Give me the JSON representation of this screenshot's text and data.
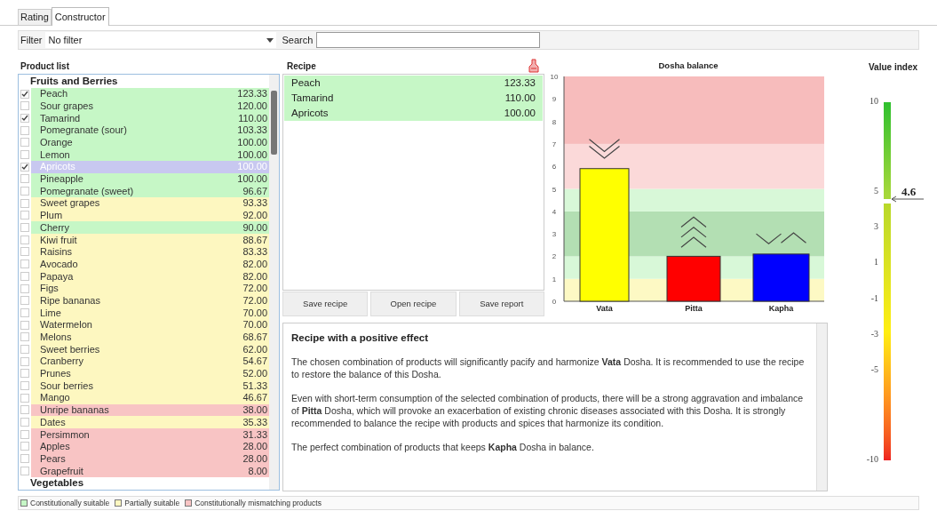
{
  "tabs": [
    {
      "label": "Rating",
      "selected": false
    },
    {
      "label": "Constructor",
      "selected": true
    }
  ],
  "filter": {
    "label": "Filter",
    "value": "No filter"
  },
  "search": {
    "label": "Search"
  },
  "product_list": {
    "title": "Product list",
    "groups": [
      {
        "name": "Fruits and Berries",
        "items": [
          {
            "name": "Peach",
            "value": "123.33",
            "checked": true,
            "selected": false,
            "color": "#c6f7c6"
          },
          {
            "name": "Sour grapes",
            "value": "120.00",
            "checked": false,
            "selected": false,
            "color": "#c6f7c6"
          },
          {
            "name": "Tamarind",
            "value": "110.00",
            "checked": true,
            "selected": false,
            "color": "#c6f7c6"
          },
          {
            "name": "Pomegranate (sour)",
            "value": "103.33",
            "checked": false,
            "selected": false,
            "color": "#c6f7c6"
          },
          {
            "name": "Orange",
            "value": "100.00",
            "checked": false,
            "selected": false,
            "color": "#c6f7c6"
          },
          {
            "name": "Lemon",
            "value": "100.00",
            "checked": false,
            "selected": false,
            "color": "#c6f7c6"
          },
          {
            "name": "Apricots",
            "value": "100.00",
            "checked": true,
            "selected": true
          },
          {
            "name": "Pineapple",
            "value": "100.00",
            "checked": false,
            "selected": false,
            "color": "#c6f7c6"
          },
          {
            "name": "Pomegranate (sweet)",
            "value": "96.67",
            "checked": false,
            "selected": false,
            "color": "#c6f7c6"
          },
          {
            "name": "Sweet grapes",
            "value": "93.33",
            "checked": false,
            "selected": false,
            "color": "#fdf7c0"
          },
          {
            "name": "Plum",
            "value": "92.00",
            "checked": false,
            "selected": false,
            "color": "#fdf7c0"
          },
          {
            "name": "Cherry",
            "value": "90.00",
            "checked": false,
            "selected": false,
            "color": "#c6f7c6"
          },
          {
            "name": "Kiwi fruit",
            "value": "88.67",
            "checked": false,
            "selected": false,
            "color": "#fdf7c0"
          },
          {
            "name": "Raisins",
            "value": "83.33",
            "checked": false,
            "selected": false,
            "color": "#fdf7c0"
          },
          {
            "name": "Avocado",
            "value": "82.00",
            "checked": false,
            "selected": false,
            "color": "#fdf7c0"
          },
          {
            "name": "Papaya",
            "value": "82.00",
            "checked": false,
            "selected": false,
            "color": "#fdf7c0"
          },
          {
            "name": "Figs",
            "value": "72.00",
            "checked": false,
            "selected": false,
            "color": "#fdf7c0"
          },
          {
            "name": "Ripe bananas",
            "value": "72.00",
            "checked": false,
            "selected": false,
            "color": "#fdf7c0"
          },
          {
            "name": "Lime",
            "value": "70.00",
            "checked": false,
            "selected": false,
            "color": "#fdf7c0"
          },
          {
            "name": "Watermelon",
            "value": "70.00",
            "checked": false,
            "selected": false,
            "color": "#fdf7c0"
          },
          {
            "name": "Melons",
            "value": "68.67",
            "checked": false,
            "selected": false,
            "color": "#fdf7c0"
          },
          {
            "name": "Sweet berries",
            "value": "62.00",
            "checked": false,
            "selected": false,
            "color": "#fdf7c0"
          },
          {
            "name": "Cranberry",
            "value": "54.67",
            "checked": false,
            "selected": false,
            "color": "#fdf7c0"
          },
          {
            "name": "Prunes",
            "value": "52.00",
            "checked": false,
            "selected": false,
            "color": "#fdf7c0"
          },
          {
            "name": "Sour berries",
            "value": "51.33",
            "checked": false,
            "selected": false,
            "color": "#fdf7c0"
          },
          {
            "name": "Mango",
            "value": "46.67",
            "checked": false,
            "selected": false,
            "color": "#fdf7c0"
          },
          {
            "name": "Unripe bananas",
            "value": "38.00",
            "checked": false,
            "selected": false,
            "color": "#f8c4c4"
          },
          {
            "name": "Dates",
            "value": "35.33",
            "checked": false,
            "selected": false,
            "color": "#fdf7c0"
          },
          {
            "name": "Persimmon",
            "value": "31.33",
            "checked": false,
            "selected": false,
            "color": "#f8c4c4"
          },
          {
            "name": "Apples",
            "value": "28.00",
            "checked": false,
            "selected": false,
            "color": "#f8c4c4"
          },
          {
            "name": "Pears",
            "value": "28.00",
            "checked": false,
            "selected": false,
            "color": "#f8c4c4"
          },
          {
            "name": "Grapefruit",
            "value": "8.00",
            "checked": false,
            "selected": false,
            "color": "#f8c4c4"
          }
        ]
      },
      {
        "name": "Vegetables"
      }
    ]
  },
  "recipe": {
    "title": "Recipe",
    "items": [
      {
        "name": "Peach",
        "value": "123.33"
      },
      {
        "name": "Tamarind",
        "value": "110.00"
      },
      {
        "name": "Apricots",
        "value": "100.00"
      }
    ],
    "buttons": [
      "Save recipe",
      "Open recipe",
      "Save report"
    ]
  },
  "dosha_balance": {
    "chart_data": {
      "type": "bar",
      "title": "Dosha balance",
      "categories": [
        "Vata",
        "Pitta",
        "Kapha"
      ],
      "values": [
        5.9,
        2.0,
        2.1
      ],
      "colors": [
        "#ffff00",
        "#ff0000",
        "#0000ff"
      ],
      "ylim": [
        0,
        10
      ],
      "yticks": [
        0,
        1,
        2,
        3,
        4,
        5,
        6,
        7,
        8,
        9,
        10
      ]
    },
    "markers": [
      {
        "kind": "down"
      },
      {
        "kind": "up"
      },
      {
        "kind": "balanced"
      }
    ]
  },
  "description": {
    "title": "Recipe with a positive effect",
    "paragraphs": [
      "The chosen combination of products will significantly pacify and harmonize **Vata** Dosha. It is recommended to use the recipe to restore the balance of this Dosha.",
      "Even with short-term consumption of the selected combination of products, there will be a strong aggravation and imbalance of **Pitta** Dosha, which will provoke an exacerbation of existing chronic diseases associated with this Dosha. It is strongly recommended to balance the recipe with products and spices that harmonize its condition.",
      "The perfect combination of products that keeps **Kapha** Dosha in balance."
    ]
  },
  "value_index": {
    "title": "Value index",
    "ticks": [
      "10",
      "5",
      "3",
      "1",
      "-1",
      "-3",
      "-5",
      "-10"
    ],
    "level": 0.73,
    "reading": "4.6"
  },
  "legend": [
    {
      "label": "Constitutionally suitable",
      "color": "#c6f7c6"
    },
    {
      "label": "Partially suitable",
      "color": "#fdf7c0"
    },
    {
      "label": "Constitutionally mismatching products",
      "color": "#f8c4c4"
    }
  ]
}
